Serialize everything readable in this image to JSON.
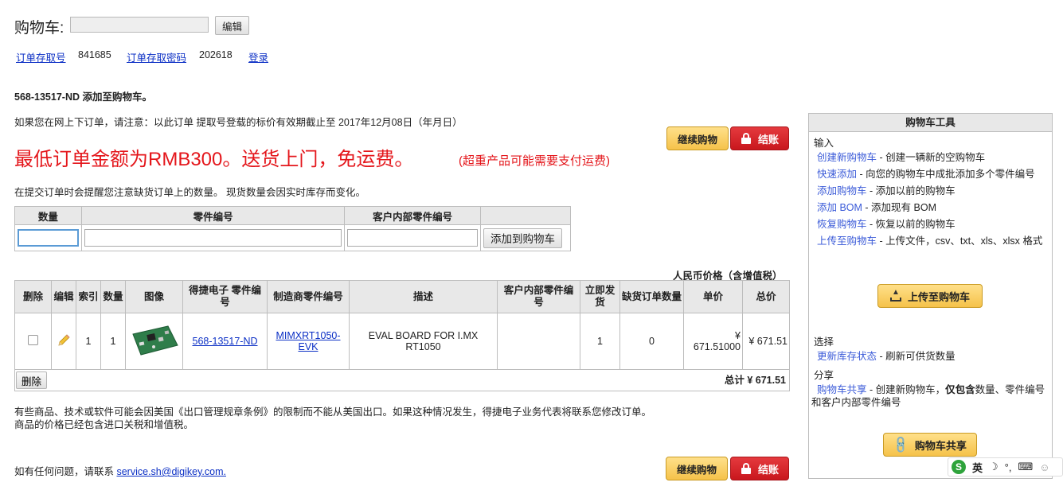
{
  "header": {
    "cart_label": "购物车:",
    "cart_name_value": "",
    "edit_label": "编辑"
  },
  "order": {
    "retrieval_no_label": "订单存取号",
    "retrieval_no": "841685",
    "retrieval_pwd_label": "订单存取密码",
    "retrieval_pwd": "202618",
    "login_label": "登录"
  },
  "messages": {
    "added": "568-13517-ND 添加至购物车。",
    "notice": "如果您在网上下订单，请注意：以此订单 提取号登载的标价有效期截止至 2017年12月08日（年月日）",
    "min_order": "最低订单金额为RMB300。送货上门，免运费。",
    "min_order_sub": "(超重产品可能需要支付运费)",
    "reminder": "在提交订单时会提醒您注意缺货订单上的数量。 现货数量会因实时库存而变化。",
    "price_note": "人民币价格（含增值税）",
    "export_line1": "有些商品、技术或软件可能会因美国《出口管理规章条例》的限制而不能从美国出口。如果这种情况发生，得捷电子业务代表将联系您修改订单。",
    "export_line2": "商品的价格已经包含进口关税和增值税。",
    "contact_prefix": "如有任何问题，请联系 ",
    "contact_email": "service.sh@digikey.com."
  },
  "buttons": {
    "continue_shopping": "继续购物",
    "checkout": "结账",
    "add_to_cart": "添加到购物车",
    "delete": "删除"
  },
  "quick_add": {
    "headers": [
      "数量",
      "零件编号",
      "客户内部零件编号"
    ]
  },
  "cart_table": {
    "headers": [
      "删除",
      "编辑",
      "索引",
      "数量",
      "图像",
      "得捷电子 零件编号",
      "制造商零件编号",
      "描述",
      "客户内部零件编号",
      "立即发货",
      "缺货订单数量",
      "单价",
      "总价"
    ],
    "rows": [
      {
        "index": "1",
        "qty": "1",
        "digikey_pn": "568-13517-ND",
        "mfr_pn": "MIMXRT1050-EVK",
        "description": "EVAL BOARD FOR I.MX RT1050",
        "customer_pn": "",
        "ship_now": "1",
        "backorder": "0",
        "unit_price": "¥ 671.51000",
        "ext_price": "¥ 671.51"
      }
    ],
    "total": "总计 ¥ 671.51"
  },
  "tools": {
    "title": "购物车工具",
    "input_section": "输入",
    "items": [
      {
        "link": "创建新购物车",
        "desc": " - 创建一辆新的空购物车"
      },
      {
        "link": "快速添加",
        "desc": " - 向您的购物车中成批添加多个零件编号"
      },
      {
        "link": "添加购物车",
        "desc": " - 添加以前的购物车"
      },
      {
        "link": "添加 BOM",
        "desc": " - 添加现有 BOM"
      },
      {
        "link": "恢复购物车",
        "desc": " - 恢复以前的购物车"
      },
      {
        "link": "上传至购物车",
        "desc": " - 上传文件，csv、txt、xls、xlsx 格式"
      }
    ],
    "upload_button": "上传至购物车",
    "select_section": "选择",
    "refresh_link": "更新库存状态",
    "refresh_desc": " - 刷新可供货数量",
    "share_section": "分享",
    "share_link": "购物车共享",
    "share_desc1": " - 创建新购物车，",
    "share_desc_bold": "仅包含",
    "share_desc2": "数量、零件编号和客户内部零件编号",
    "share_button": "购物车共享"
  },
  "ime": {
    "lang": "英"
  },
  "colors": {
    "accent_red": "#e4161b",
    "button_gold": "#f5c24a",
    "checkout_red": "#c9171d",
    "link_blue": "#0b2fc5"
  }
}
